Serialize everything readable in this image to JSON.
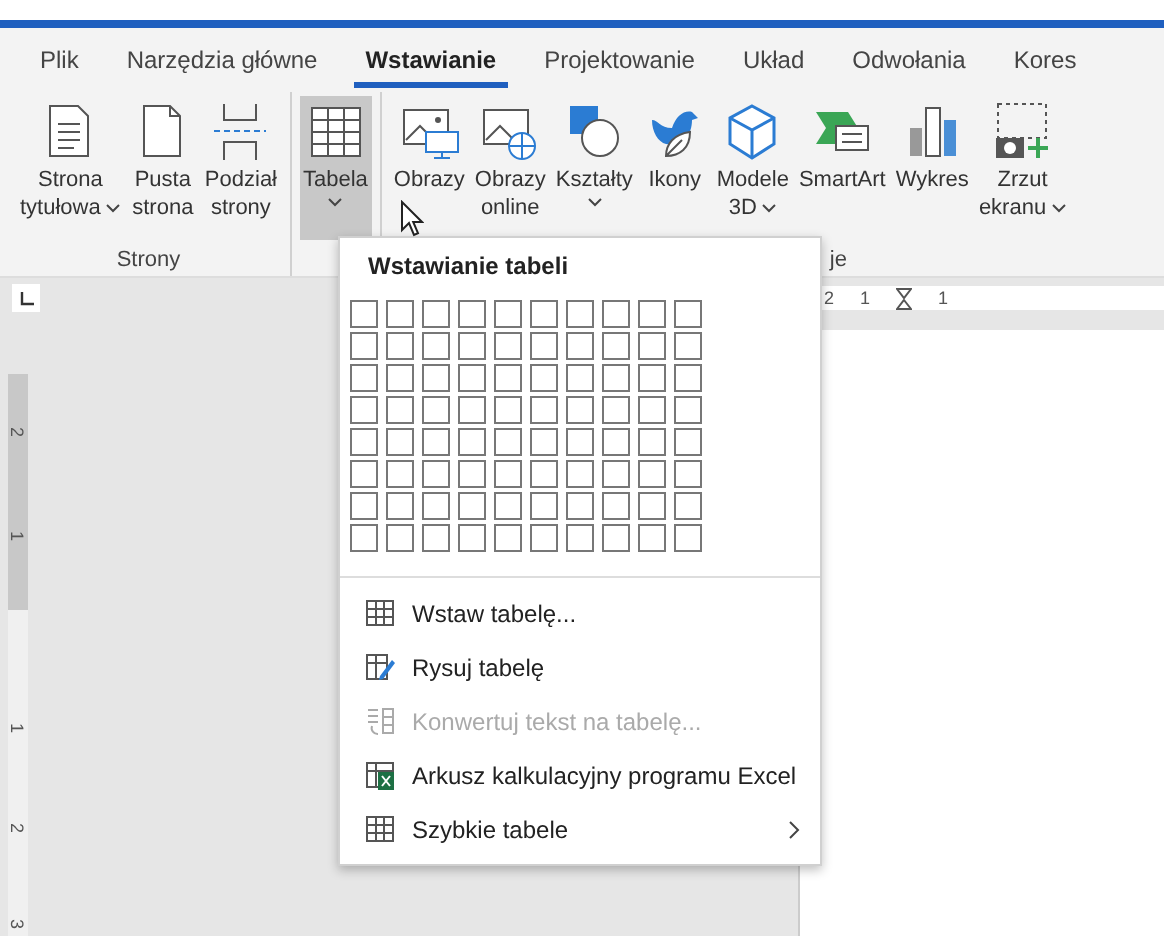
{
  "tabs": [
    {
      "label": "Plik",
      "selected": false
    },
    {
      "label": "Narzędzia główne",
      "selected": false
    },
    {
      "label": "Wstawianie",
      "selected": true
    },
    {
      "label": "Projektowanie",
      "selected": false
    },
    {
      "label": "Układ",
      "selected": false
    },
    {
      "label": "Odwołania",
      "selected": false
    },
    {
      "label": "Kores",
      "selected": false
    }
  ],
  "ribbon": {
    "groups": [
      {
        "label": "Strony",
        "buttons": [
          {
            "kind": "cover",
            "label": "Strona\ntytułowa",
            "dropdown": true,
            "selected": false
          },
          {
            "kind": "blank",
            "label": "Pusta\nstrona",
            "dropdown": false,
            "selected": false
          },
          {
            "kind": "break",
            "label": "Podział\nstrony",
            "dropdown": false,
            "selected": false
          }
        ]
      },
      {
        "buttons": [
          {
            "kind": "table",
            "label": "Tabela",
            "dropdown": true,
            "selected": true
          }
        ]
      },
      {
        "label": "je",
        "buttons": [
          {
            "kind": "pictures",
            "label": "Obrazy",
            "dropdown": false,
            "selected": false
          },
          {
            "kind": "online",
            "label": "Obrazy\nonline",
            "dropdown": false,
            "selected": false
          },
          {
            "kind": "shapes",
            "label": "Kształty",
            "dropdown": true,
            "selected": false
          },
          {
            "kind": "icons",
            "label": "Ikony",
            "dropdown": false,
            "selected": false
          },
          {
            "kind": "cube",
            "label": "Modele\n3D",
            "dropdown": true,
            "selected": false
          },
          {
            "kind": "smartart",
            "label": "SmartArt",
            "dropdown": false,
            "selected": false
          },
          {
            "kind": "chart",
            "label": "Wykres",
            "dropdown": false,
            "selected": false
          },
          {
            "kind": "screenshot",
            "label": "Zrzut\nekranu",
            "dropdown": true,
            "selected": false
          }
        ]
      }
    ]
  },
  "table_menu": {
    "title": "Wstawianie tabeli",
    "items": [
      {
        "kind": "table",
        "label": "Wstaw tabelę...",
        "disabled": false,
        "submenu": false
      },
      {
        "kind": "draw",
        "label": "Rysuj tabelę",
        "disabled": false,
        "submenu": false
      },
      {
        "kind": "convert",
        "label": "Konwertuj tekst na tabelę...",
        "disabled": true,
        "submenu": false
      },
      {
        "kind": "excel",
        "label": "Arkusz kalkulacyjny programu Excel",
        "disabled": false,
        "submenu": false
      },
      {
        "kind": "table",
        "label": "Szybkie tabele",
        "disabled": false,
        "submenu": true
      }
    ]
  },
  "ruler": {
    "horizontal_labels": [
      "2",
      "1",
      "1"
    ],
    "vertical_labels": [
      "2",
      "1",
      "1",
      "2",
      "3"
    ]
  }
}
